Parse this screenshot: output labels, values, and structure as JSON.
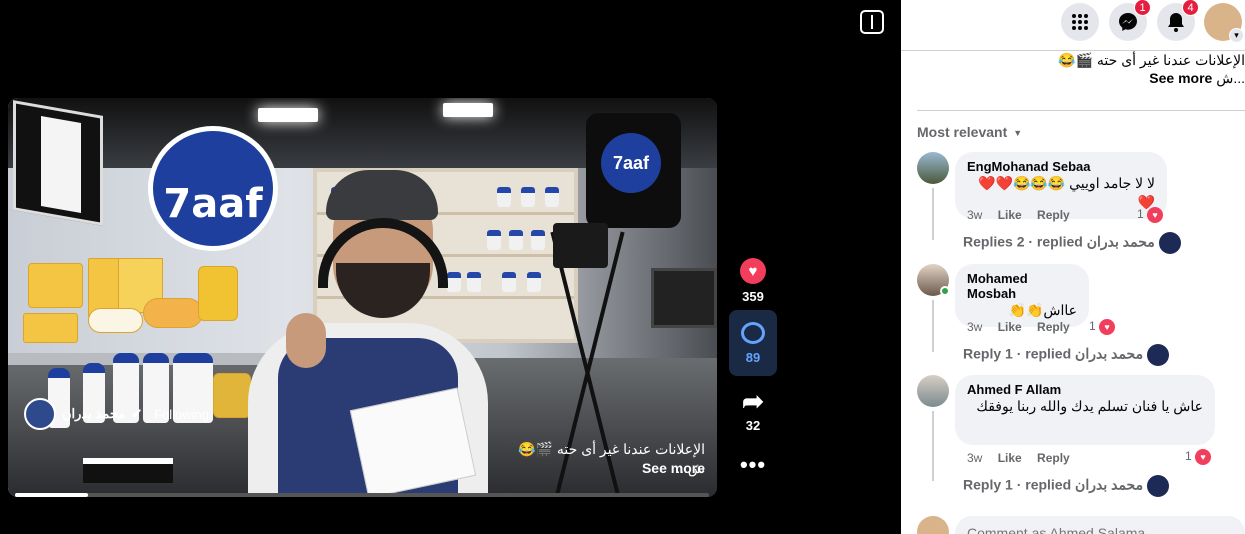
{
  "video": {
    "owner_name": "محمد بدران",
    "follow_label": "Following",
    "caption": "الإعلانات عندنا غير أى حته 🎬😂 ش...",
    "see_more": "See more",
    "progress": 0.105,
    "brand_text": "7aaf"
  },
  "actions": {
    "likes": "359",
    "comments": "89",
    "shares": "32",
    "more": "•••"
  },
  "topbar": {
    "messenger_badge": "1",
    "notif_badge": "4"
  },
  "panel": {
    "caption": "الإعلانات عندنا غير أى حته 🎬😂",
    "caption_cont": "ش...",
    "see_more": "See more",
    "sort_label": "Most relevant"
  },
  "comments": [
    {
      "author": "EngMohanad Sebaa",
      "text": "لا لا جامد اوييي 😂😂😂❤️❤️❤️",
      "time": "3w",
      "like": "Like",
      "reply": "Reply",
      "reactions": "1",
      "replies": "Replies 2 · replied محمد بدران"
    },
    {
      "author": "Mohamed Mosbah",
      "text": "عااش👏👏",
      "time": "3w",
      "like": "Like",
      "reply": "Reply",
      "reactions": "1",
      "replies": "Reply 1 · replied محمد بدران"
    },
    {
      "author": "Ahmed F Allam",
      "text": "عاش يا فنان تسلم يدك والله ربنا يوفقك",
      "time": "3w",
      "like": "Like",
      "reply": "Reply",
      "reactions": "1",
      "replies": "Reply 1 · replied محمد بدران"
    }
  ],
  "composer": {
    "placeholder": "Comment as Ahmed Salama"
  },
  "colors": {
    "like_red": "#f23e5c",
    "comment_blue": "#63a3ff",
    "badge_red": "#e41e3f"
  }
}
